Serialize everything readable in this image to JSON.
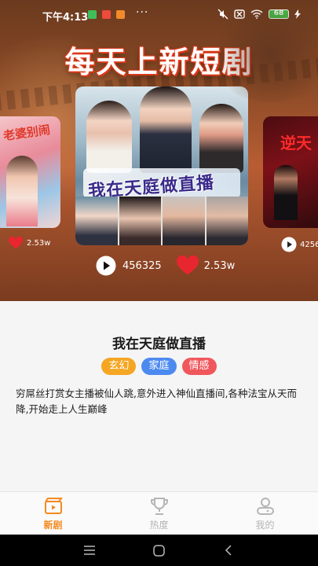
{
  "status_bar": {
    "time": "下午4:13",
    "dots": "···",
    "battery": "68"
  },
  "hero": {
    "headline": "每天上新短剧",
    "left_poster": {
      "title_text": "老婆别闹",
      "likes": "2.53w"
    },
    "center_poster": {
      "title_text": "我在天庭做直播"
    },
    "right_poster": {
      "title_text": "逆天",
      "plays": "4256"
    },
    "plays": "456325",
    "likes": "2.53w"
  },
  "drama": {
    "title": "我在天庭做直播",
    "tags": [
      {
        "label": "玄幻",
        "color": "#f5a623"
      },
      {
        "label": "家庭",
        "color": "#4d8af0"
      },
      {
        "label": "情感",
        "color": "#f0575c"
      }
    ],
    "description": "穷屌丝打赏女主播被仙人跳,意外进入神仙直播间,各种法宝从天而降,开始走上人生巅峰"
  },
  "nav": {
    "items": [
      {
        "label": "新剧",
        "icon": "clapperboard-icon",
        "active": true
      },
      {
        "label": "热度",
        "icon": "trophy-icon",
        "active": false
      },
      {
        "label": "我的",
        "icon": "user-icon",
        "active": false
      }
    ]
  },
  "colors": {
    "accent": "#f58a1f",
    "heart": "#e8262f",
    "inactive": "#b5b5b5"
  }
}
